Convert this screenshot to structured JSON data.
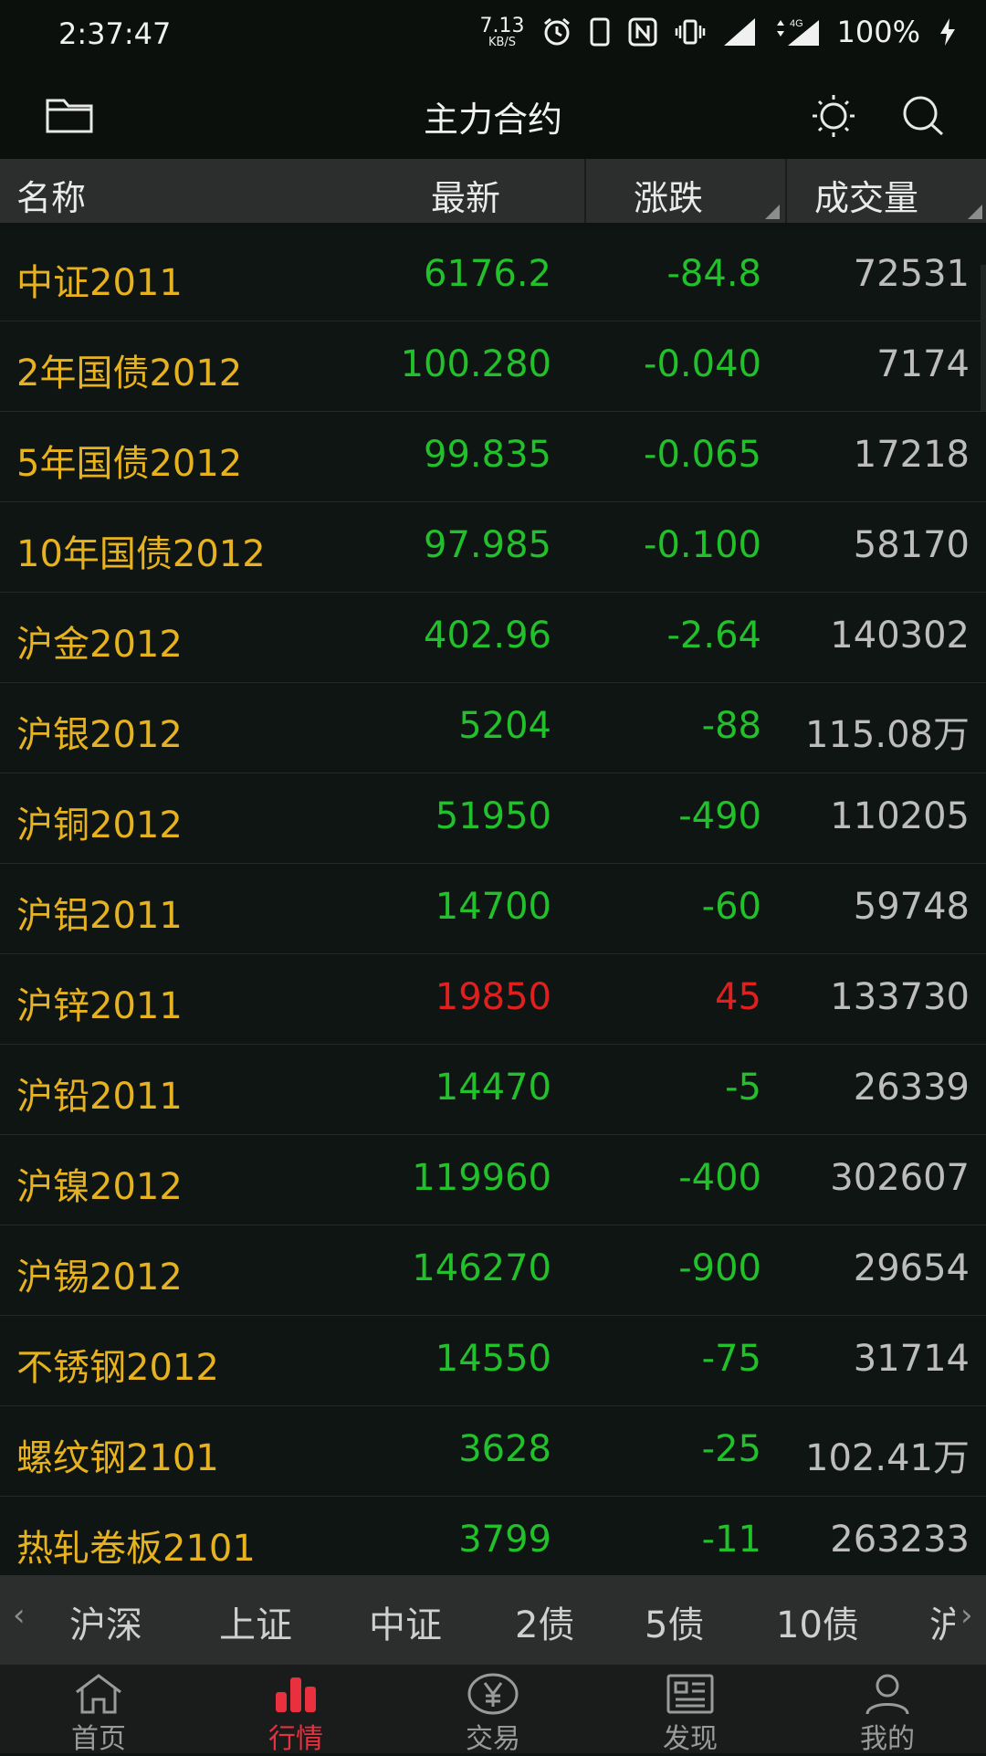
{
  "status": {
    "time": "2:37:47",
    "net_speed": "7.13",
    "net_unit": "KB/S",
    "battery": "100%"
  },
  "titlebar": {
    "title": "主力合约"
  },
  "columns": {
    "name": "名称",
    "last": "最新",
    "change": "涨跌",
    "volume": "成交量"
  },
  "rows": [
    {
      "name": "中证2011",
      "last": "6176.2",
      "change": "-84.8",
      "volume": "72531",
      "dir": "down"
    },
    {
      "name": "2年国债2012",
      "last": "100.280",
      "change": "-0.040",
      "volume": "7174",
      "dir": "down"
    },
    {
      "name": "5年国债2012",
      "last": "99.835",
      "change": "-0.065",
      "volume": "17218",
      "dir": "down"
    },
    {
      "name": "10年国债2012",
      "last": "97.985",
      "change": "-0.100",
      "volume": "58170",
      "dir": "down"
    },
    {
      "name": "沪金2012",
      "last": "402.96",
      "change": "-2.64",
      "volume": "140302",
      "dir": "down"
    },
    {
      "name": "沪银2012",
      "last": "5204",
      "change": "-88",
      "volume": "115.08万",
      "dir": "down"
    },
    {
      "name": "沪铜2012",
      "last": "51950",
      "change": "-490",
      "volume": "110205",
      "dir": "down"
    },
    {
      "name": "沪铝2011",
      "last": "14700",
      "change": "-60",
      "volume": "59748",
      "dir": "down"
    },
    {
      "name": "沪锌2011",
      "last": "19850",
      "change": "45",
      "volume": "133730",
      "dir": "up"
    },
    {
      "name": "沪铅2011",
      "last": "14470",
      "change": "-5",
      "volume": "26339",
      "dir": "down"
    },
    {
      "name": "沪镍2012",
      "last": "119960",
      "change": "-400",
      "volume": "302607",
      "dir": "down"
    },
    {
      "name": "沪锡2012",
      "last": "146270",
      "change": "-900",
      "volume": "29654",
      "dir": "down"
    },
    {
      "name": "不锈钢2012",
      "last": "14550",
      "change": "-75",
      "volume": "31714",
      "dir": "down"
    },
    {
      "name": "螺纹钢2101",
      "last": "3628",
      "change": "-25",
      "volume": "102.41万",
      "dir": "down"
    },
    {
      "name": "热轧卷板2101",
      "last": "3799",
      "change": "-11",
      "volume": "263233",
      "dir": "down"
    }
  ],
  "market_tabs": {
    "left_arrow": "‹",
    "right_arrow": "›",
    "items": [
      "沪深",
      "上证",
      "中证",
      "2债",
      "5债",
      "10债",
      "沪"
    ]
  },
  "nav": {
    "items": [
      {
        "label": "首页",
        "icon": "home-icon"
      },
      {
        "label": "行情",
        "icon": "chart-bars-icon"
      },
      {
        "label": "交易",
        "icon": "yuan-icon"
      },
      {
        "label": "发现",
        "icon": "news-icon"
      },
      {
        "label": "我的",
        "icon": "user-icon"
      }
    ],
    "active": "行情"
  },
  "colors": {
    "name": "#e7b21f",
    "down": "#22c02a",
    "up": "#e0201f",
    "active_nav": "#e8303e"
  }
}
